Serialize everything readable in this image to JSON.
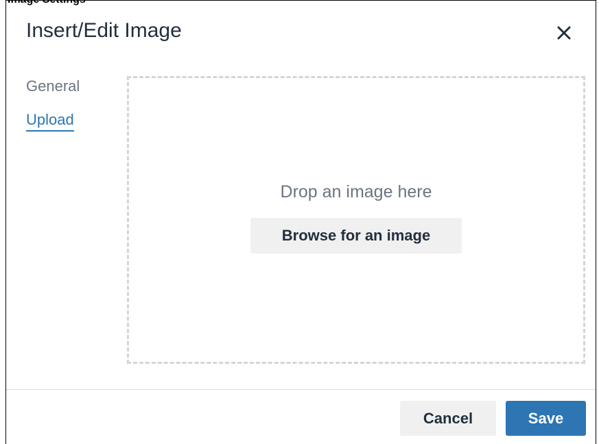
{
  "clipped_header_text": "Image Settings",
  "dialog": {
    "title": "Insert/Edit Image",
    "close_icon": "close-icon"
  },
  "tabs": [
    {
      "label": "General",
      "active": false
    },
    {
      "label": "Upload",
      "active": true
    }
  ],
  "upload": {
    "drop_text": "Drop an image here",
    "browse_label": "Browse for an image"
  },
  "footer": {
    "cancel_label": "Cancel",
    "save_label": "Save"
  },
  "colors": {
    "accent": "#2d75b3",
    "title_text": "#222f3e",
    "muted_text": "#6b7480",
    "button_bg": "#f0f0f0",
    "dash_border": "#d3d5d8"
  }
}
